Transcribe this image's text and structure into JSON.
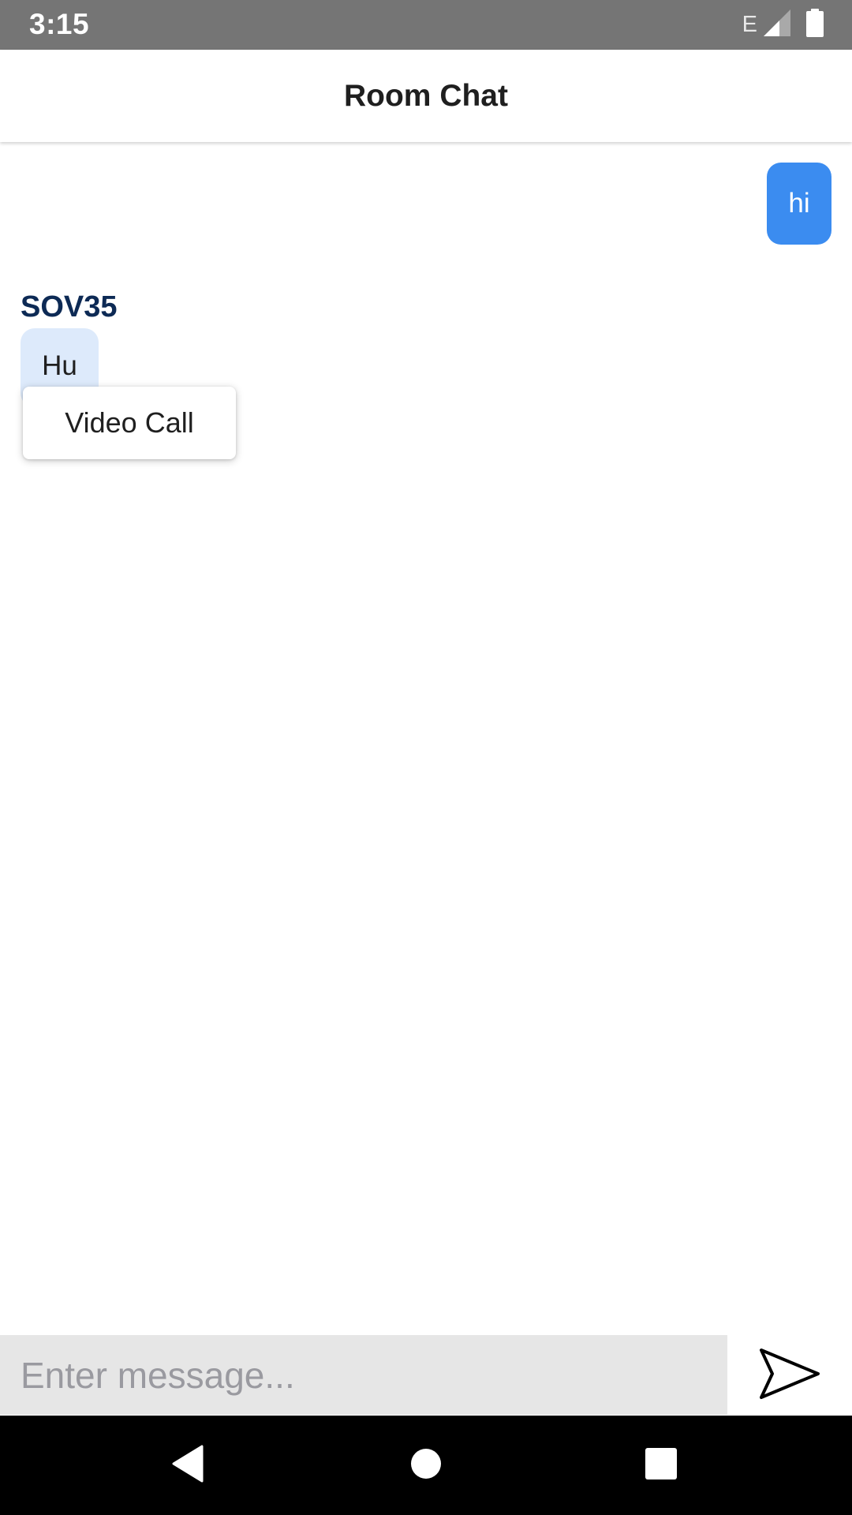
{
  "status_bar": {
    "time": "3:15",
    "network_type": "E",
    "icons": [
      "signal-icon",
      "battery-icon"
    ]
  },
  "header": {
    "title": "Room Chat"
  },
  "messages": [
    {
      "direction": "outgoing",
      "text": "hi"
    },
    {
      "direction": "incoming",
      "sender": "SOV35",
      "text": "Hu"
    }
  ],
  "context_menu": {
    "items": [
      "Video Call"
    ]
  },
  "composer": {
    "placeholder": "Enter message...",
    "value": "",
    "send_icon": "send-icon"
  },
  "nav_bar": {
    "icons": [
      "back-icon",
      "home-icon",
      "recents-icon"
    ]
  },
  "colors": {
    "status_bar_bg": "#757575",
    "outgoing_bubble": "#3b8cf0",
    "incoming_bubble": "#ddeafb",
    "sender_name": "#0d2a55",
    "input_bg": "#e6e6e6",
    "nav_bar_bg": "#000000"
  }
}
